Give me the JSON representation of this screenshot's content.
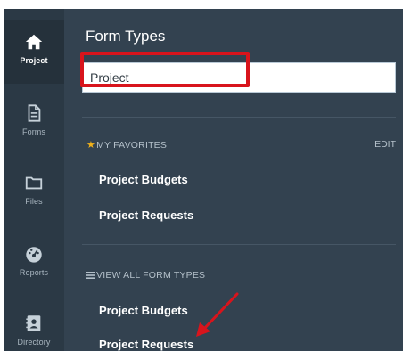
{
  "nav": {
    "items": [
      {
        "label": "Project",
        "icon": "home-icon",
        "active": true
      },
      {
        "label": "Forms",
        "icon": "document-icon",
        "active": false
      },
      {
        "label": "Files",
        "icon": "folder-icon",
        "active": false
      },
      {
        "label": "Reports",
        "icon": "gauge-icon",
        "active": false
      },
      {
        "label": "Directory",
        "icon": "contact-book-icon",
        "active": false
      }
    ]
  },
  "panel": {
    "title": "Form Types",
    "search": {
      "value": "Project",
      "placeholder": ""
    },
    "favorites": {
      "heading": "MY FAVORITES",
      "edit_label": "EDIT",
      "items": [
        "Project Budgets",
        "Project Requests"
      ]
    },
    "all_types": {
      "heading": "VIEW ALL FORM TYPES",
      "items": [
        "Project Budgets",
        "Project Requests"
      ]
    }
  },
  "colors": {
    "rail_bg": "#2b3945",
    "panel_bg": "#334250",
    "highlight": "#d8141c",
    "star": "#f2b21a"
  }
}
